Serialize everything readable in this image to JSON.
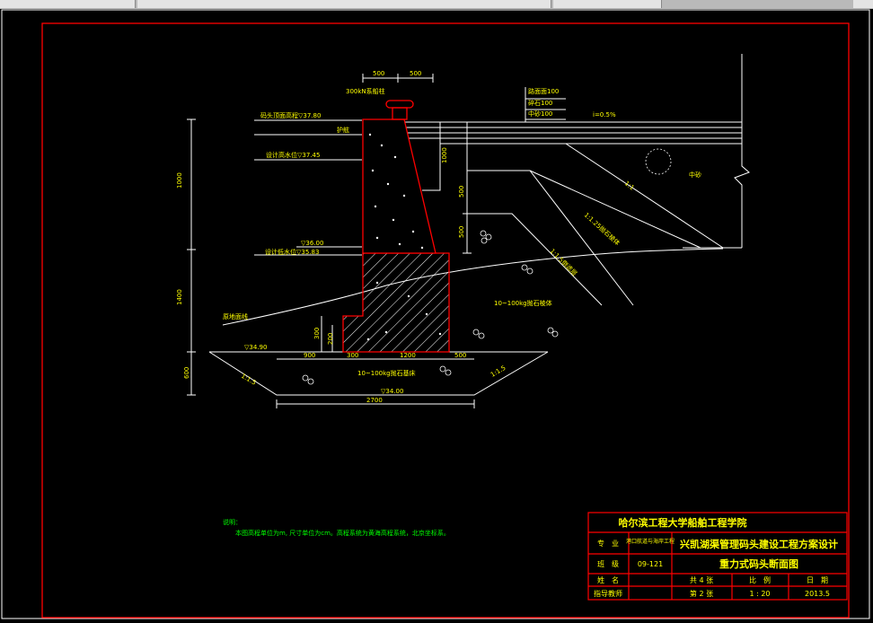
{
  "drawing": {
    "dims_top": [
      "500",
      "500"
    ],
    "bollard_label": "300kN系船柱",
    "road_layers": [
      "路面面100",
      "碎石100",
      "中砂100"
    ],
    "slope_top": "i=0.5%",
    "top_elev_label": "码头顶面高程▽37.80",
    "beam_label": "护舷",
    "design_high_water": "设计高水位▽37.45",
    "design_low_water": "设计低水位▽35.83",
    "elev_36": "▽36.00",
    "seabed_line": "原地面线",
    "elev_3490": "▽34.90",
    "elev_3400": "▽34.00",
    "left_dims": [
      "1000",
      "1400",
      "600"
    ],
    "mid_dims": [
      "1000",
      "500",
      "500"
    ],
    "small_dims": [
      "300",
      "200"
    ],
    "bottom_dims": [
      "900",
      "300",
      "1200",
      "500"
    ],
    "total_width": "2700",
    "slope_a": "1:1.5",
    "slope_b": "1:1.5",
    "backfill_slopes": [
      "1:1",
      "1:1.25抛石棱体",
      "1:1.5倒滤层"
    ],
    "rubble_upper": "10~100kg抛石棱体",
    "rubble_lower": "10~100kg抛石基床",
    "medium_sand": "中砂"
  },
  "notes": {
    "title": "说明：",
    "line1": "本图高程单位为m, 尺寸单位为cm。高程系统为黄海高程系统，北京坐标系。"
  },
  "title_block": {
    "school": "哈尔滨工程大学船舶工程学院",
    "major_label": "专　业",
    "major_value": "港口航道与海岸工程",
    "class_label": "班　级",
    "class_value": "09-121",
    "name_label": "姓　名",
    "advisor_label": "指导教师",
    "project_title": "兴凯湖渠管理码头建设工程方案设计",
    "drawing_title": "重力式码头断面图",
    "sheets_total": "共 4 张",
    "sheet_no": "第 2 张",
    "scale_label": "比　例",
    "scale_value": "1 : 20",
    "date_label": "日　期",
    "date_value": "2013.5"
  },
  "colors": {
    "frame": "#ff0000",
    "line": "#ffffff",
    "text_green": "#00ff00",
    "text_yellow": "#ffff00",
    "dim_white": "#ffffff"
  }
}
